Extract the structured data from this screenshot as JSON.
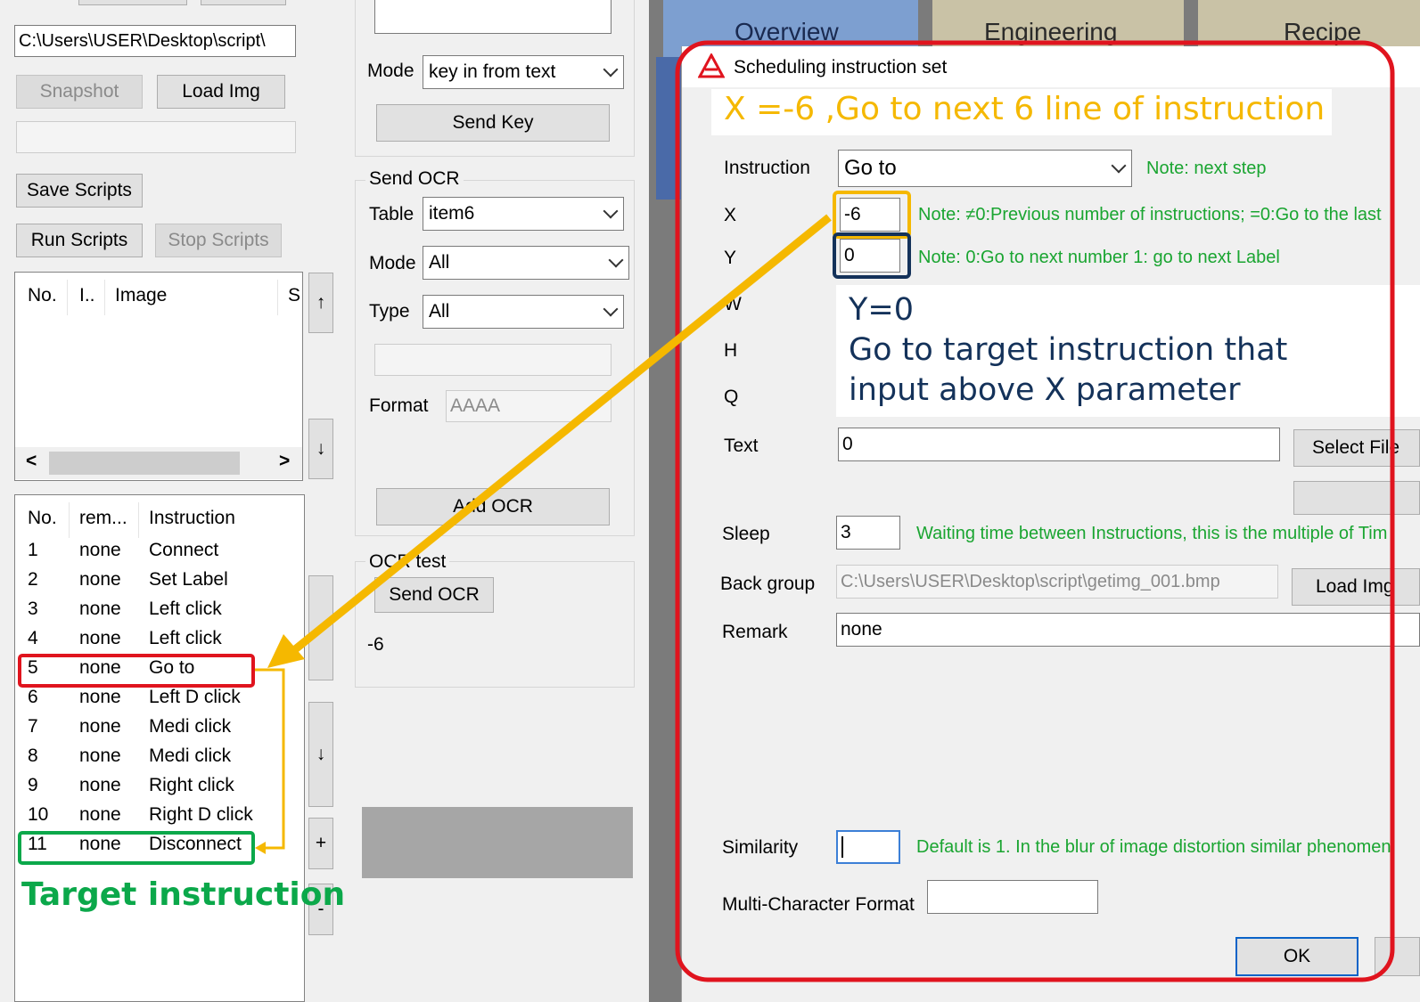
{
  "left_panel": {
    "path_value": "C:\\Users\\USER\\Desktop\\script\\",
    "snapshot_label": "Snapshot",
    "load_img_label": "Load Img",
    "save_scripts_label": "Save Scripts",
    "run_scripts_label": "Run Scripts",
    "stop_scripts_label": "Stop Scripts",
    "image_list": {
      "headers": [
        "No.",
        "I..",
        "Image",
        "S"
      ]
    },
    "instruction_list": {
      "headers": [
        "No.",
        "rem...",
        "Instruction"
      ],
      "rows": [
        {
          "no": "1",
          "rem": "none",
          "instr": "Connect"
        },
        {
          "no": "2",
          "rem": "none",
          "instr": "Set Label"
        },
        {
          "no": "3",
          "rem": "none",
          "instr": "Left click"
        },
        {
          "no": "4",
          "rem": "none",
          "instr": "Left click"
        },
        {
          "no": "5",
          "rem": "none",
          "instr": "Go to"
        },
        {
          "no": "6",
          "rem": "none",
          "instr": "Left D click"
        },
        {
          "no": "7",
          "rem": "none",
          "instr": "Medi click"
        },
        {
          "no": "8",
          "rem": "none",
          "instr": "Medi click"
        },
        {
          "no": "9",
          "rem": "none",
          "instr": "Right click"
        },
        {
          "no": "10",
          "rem": "none",
          "instr": "Right D click"
        },
        {
          "no": "11",
          "rem": "none",
          "instr": "Disconnect"
        }
      ]
    },
    "arrow_up": "↑",
    "arrow_down": "↓",
    "arrow_down2": "↓",
    "plus": "+",
    "minus": "-",
    "scroll_left": "<",
    "scroll_right": ">"
  },
  "middle_panel": {
    "mode_label": "Mode",
    "mode_value": "key in from text",
    "send_key_label": "Send Key",
    "send_ocr_group": "Send OCR",
    "table_label": "Table",
    "table_value": "item6",
    "mode2_label": "Mode",
    "mode2_value": "All",
    "type_label": "Type",
    "type_value": "All",
    "format_label": "Format",
    "format_value": "AAAA",
    "add_ocr_label": "Add OCR",
    "ocr_test_group": "OCR test",
    "send_ocr_label": "Send OCR",
    "ocr_result": "-6"
  },
  "tabs": [
    "Overview",
    "Engineering",
    "Recipe"
  ],
  "dialog": {
    "title": "Scheduling instruction set",
    "instruction_label": "Instruction",
    "instruction_value": "Go to",
    "instruction_note": "Note: next step",
    "x_label": "X",
    "x_value": "-6",
    "x_note": "Note: ≠0:Previous number of instructions; =0:Go to the last",
    "y_label": "Y",
    "y_value": "0",
    "y_note": "Note: 0:Go to next number 1: go to next Label",
    "w_label": "W",
    "h_label": "H",
    "q_label": "Q",
    "text_label": "Text",
    "text_value": "0",
    "select_file_label": "Select File",
    "sleep_label": "Sleep",
    "sleep_value": "3",
    "sleep_note": "Waiting time between Instructions, this is the multiple of Tim",
    "back_group_label": "Back group",
    "back_group_value": "C:\\Users\\USER\\Desktop\\script\\getimg_001.bmp",
    "load_img_label": "Load Img",
    "remark_label": "Remark",
    "remark_value": "none",
    "similarity_label": "Similarity",
    "similarity_value": "",
    "similarity_note": "Default is 1. In the blur of image distortion similar phenomen",
    "multi_char_label": "Multi-Character Format",
    "multi_char_value": "",
    "ok_label": "OK"
  },
  "annotations": {
    "x_callout": "X =-6 ,Go to next 6 line of  instruction",
    "y_callout_line1": "Y=0",
    "y_callout_line2": "Go to target instruction that",
    "y_callout_line3": "input above X parameter",
    "target_label": "Target instruction",
    "colors": {
      "orange": "#f5b800",
      "red": "#e0141e",
      "green": "#0ba84a",
      "navy": "#14325a"
    }
  }
}
